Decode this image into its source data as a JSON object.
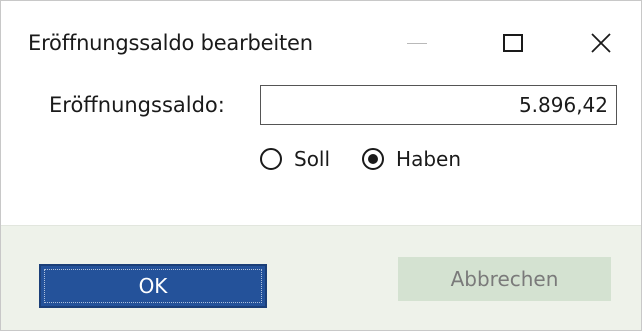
{
  "window": {
    "title": "Eröffnungssaldo bearbeiten",
    "controls": {
      "minimize": "minimize",
      "maximize": "maximize",
      "close": "close"
    }
  },
  "form": {
    "label": "Eröffnungssaldo:",
    "amount_value": "5.896,42",
    "options": [
      {
        "label": "Soll",
        "selected": false
      },
      {
        "label": "Haben",
        "selected": true
      }
    ]
  },
  "buttons": {
    "ok_label": "OK",
    "cancel_label": "Abbrechen"
  },
  "colors": {
    "ok_bg": "#24529a",
    "cancel_bg": "#d4e2d1",
    "footer_bg": "#eef2ea"
  }
}
